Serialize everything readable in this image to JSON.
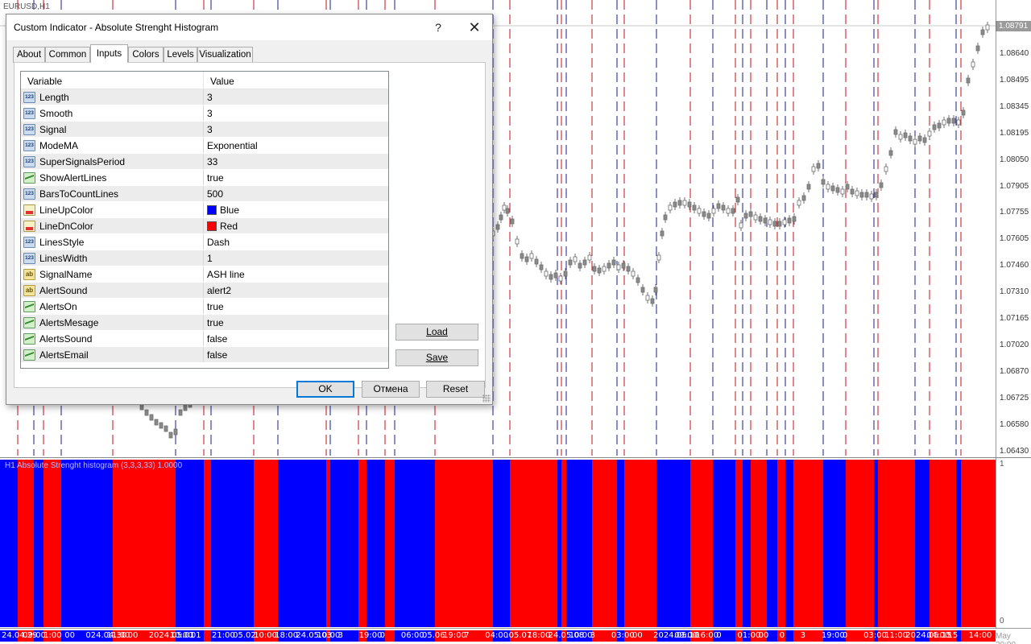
{
  "chart": {
    "symbol": "EURUSD,H1",
    "current_price": "1.08791",
    "price_ticks": [
      "1.08640",
      "1.08495",
      "1.08345",
      "1.08195",
      "1.08050",
      "1.07905",
      "1.07755",
      "1.07605",
      "1.07460",
      "1.07310",
      "1.07165",
      "1.07020",
      "1.06870",
      "1.06725",
      "1.06580",
      "1.06430"
    ],
    "indicator_title": "H1 Absolute Strenght histogram (3,3,3,33) 1.0000",
    "indicator_axis": {
      "top": "1",
      "bottom": "0"
    },
    "time_labels": [
      "24.04.29",
      "09:00",
      "1:00",
      "00",
      "024.04.30",
      "11:00",
      "00",
      "2024.05.01",
      "10:00",
      "01",
      "21:00",
      "05.02",
      "10:00",
      "18:00",
      "24.05.03",
      "10:00",
      "3",
      "19:00",
      "0",
      "06:00",
      "05.06",
      "19:00",
      "7",
      "04:00",
      ".05.07",
      "18:00",
      "24.05.08",
      "10:00",
      "3",
      "03:00",
      "00",
      "2024.05.10",
      "09:00",
      "16:00",
      "0",
      "01:00",
      "00",
      "0",
      "3",
      "19:00",
      "0",
      "03:00",
      "11:00",
      "2024.05.15",
      "04:00",
      "15",
      "14:00"
    ],
    "time_corner": "May 20:00",
    "colors": {
      "up": "#0000ff",
      "down": "#ff0000",
      "candle": "#6f6f6f"
    }
  },
  "dialog": {
    "title": "Custom Indicator - Absolute Strenght Histogram",
    "help_label": "?",
    "close_label": "✕",
    "tabs": [
      {
        "label": "About",
        "active": false
      },
      {
        "label": "Common",
        "active": false
      },
      {
        "label": "Inputs",
        "active": true
      },
      {
        "label": "Colors",
        "active": false
      },
      {
        "label": "Levels",
        "active": false
      },
      {
        "label": "Visualization",
        "active": false
      }
    ],
    "grid": {
      "header": {
        "variable": "Variable",
        "value": "Value"
      },
      "rows": [
        {
          "icon": "num",
          "label": "Length",
          "value": "3"
        },
        {
          "icon": "num",
          "label": "Smooth",
          "value": "3"
        },
        {
          "icon": "num",
          "label": "Signal",
          "value": "3"
        },
        {
          "icon": "num",
          "label": "ModeMA",
          "value": "Exponential"
        },
        {
          "icon": "num",
          "label": "SuperSignalsPeriod",
          "value": "33"
        },
        {
          "icon": "bool",
          "label": "ShowAlertLines",
          "value": "true"
        },
        {
          "icon": "num",
          "label": "BarsToCountLines",
          "value": "500"
        },
        {
          "icon": "col",
          "label": "LineUpColor",
          "value": "Blue",
          "swatch": "#0000ff"
        },
        {
          "icon": "col",
          "label": "LineDnColor",
          "value": "Red",
          "swatch": "#ff0000"
        },
        {
          "icon": "num",
          "label": "LinesStyle",
          "value": "Dash"
        },
        {
          "icon": "num",
          "label": "LinesWidth",
          "value": "1"
        },
        {
          "icon": "str",
          "label": "SignalName",
          "value": "ASH line"
        },
        {
          "icon": "str",
          "label": "AlertSound",
          "value": "alert2"
        },
        {
          "icon": "bool",
          "label": "AlertsOn",
          "value": "true"
        },
        {
          "icon": "bool",
          "label": "AlertsMesage",
          "value": "true"
        },
        {
          "icon": "bool",
          "label": "AlertsSound",
          "value": "false"
        },
        {
          "icon": "bool",
          "label": "AlertsEmail",
          "value": "false"
        }
      ]
    },
    "buttons": {
      "load": "Load",
      "save": "Save",
      "ok": "OK",
      "cancel": "Отмена",
      "reset": "Reset"
    }
  }
}
